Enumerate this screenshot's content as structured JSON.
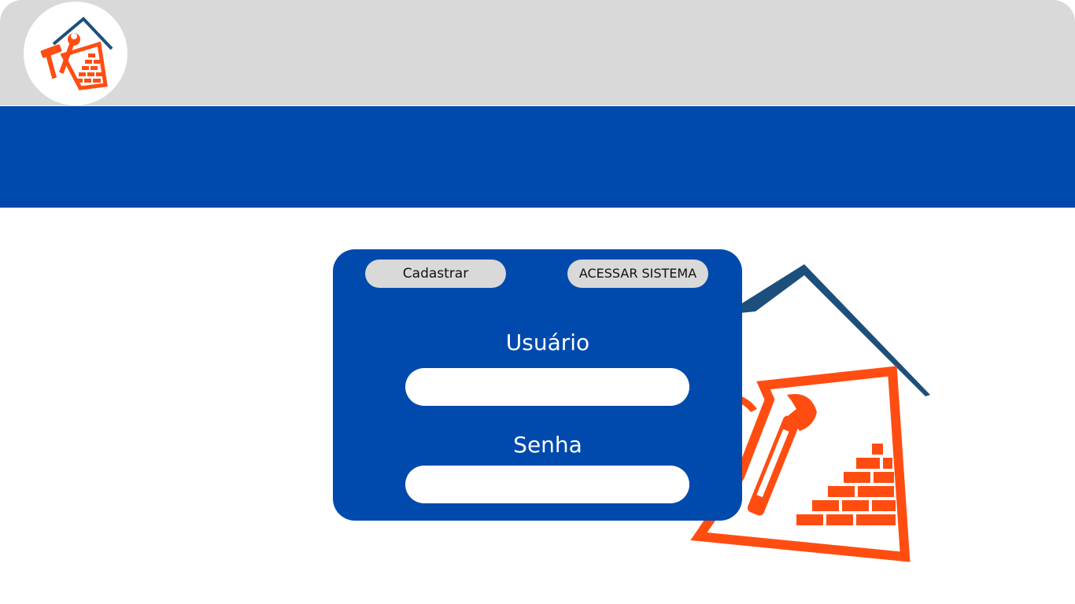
{
  "header": {
    "logo_icon": "house-tools-logo-icon"
  },
  "hero": {
    "icon": "house-tools-brick-icon"
  },
  "login": {
    "register_label": "Cadastrar",
    "access_label": "ACESSAR SISTEMA",
    "user_label": "Usuário",
    "user_value": "",
    "password_label": "Senha",
    "password_value": ""
  },
  "colors": {
    "header_gray": "#d9d9d9",
    "brand_blue": "#004aad",
    "roof_blue": "#1c4f7c",
    "tool_orange": "#ff4d12",
    "button_gray": "#d9d9d9"
  }
}
